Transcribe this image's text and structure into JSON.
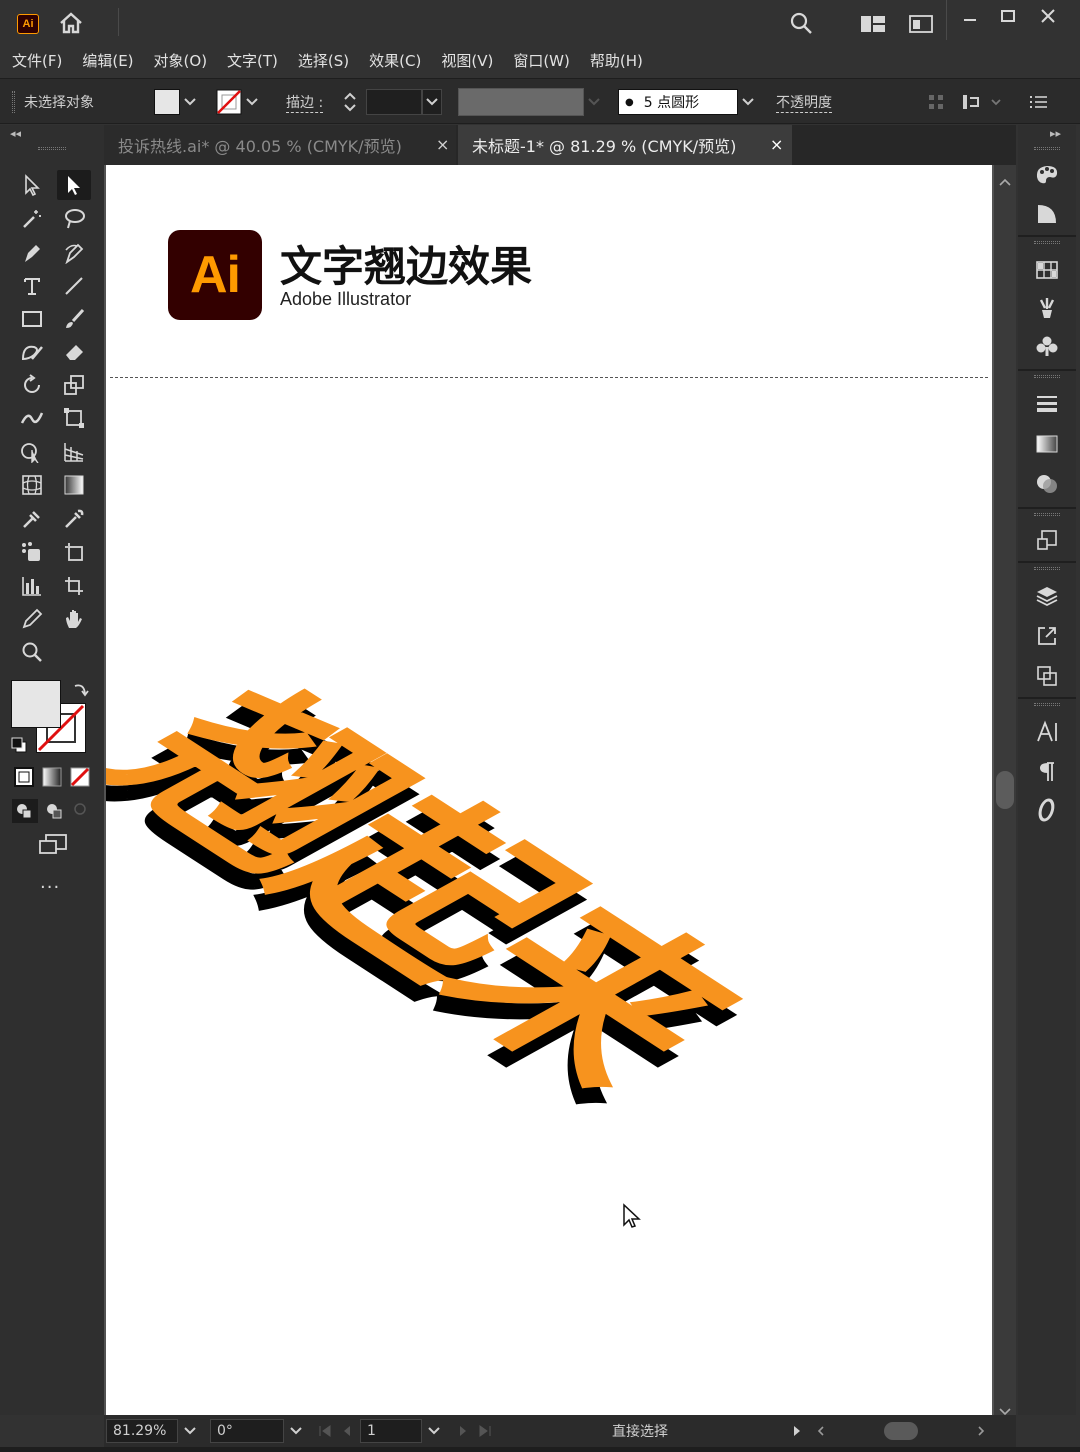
{
  "app": {
    "badge": "Ai"
  },
  "menu": [
    "文件(F)",
    "编辑(E)",
    "对象(O)",
    "文字(T)",
    "选择(S)",
    "效果(C)",
    "视图(V)",
    "窗口(W)",
    "帮助(H)"
  ],
  "control": {
    "selection_label": "未选择对象",
    "stroke_label": "描边 :",
    "brush_dot": "●",
    "brush_value": "5 点圆形",
    "opacity_label": "不透明度"
  },
  "tabs": [
    {
      "label": "投诉热线.ai* @ 40.05 % (CMYK/预览)",
      "close": "×",
      "active": false
    },
    {
      "label": "未标题-1* @ 81.29 % (CMYK/预览)",
      "close": "×",
      "active": true
    }
  ],
  "artboard": {
    "logo_text": "Ai",
    "title": "文字翘边效果",
    "subtitle": "Adobe Illustrator",
    "warp_text": "翘起来",
    "warp_color": "#f7931e",
    "shadow_color": "#000000"
  },
  "status": {
    "zoom": "81.29%",
    "rotation": "0°",
    "page": "1",
    "tool_name": "直接选择"
  },
  "toolbar": {
    "more": "···"
  },
  "colors": {
    "accent": "#ff9a00",
    "logo_bg": "#330000",
    "ui_bg": "#323232"
  }
}
